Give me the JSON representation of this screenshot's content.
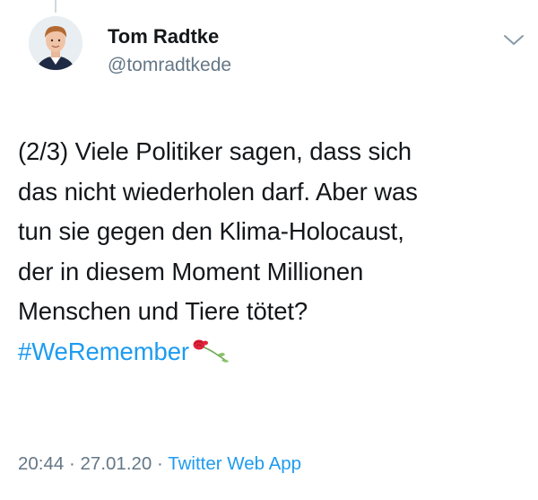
{
  "author": {
    "display_name": "Tom Radtke",
    "handle": "@tomradtkede"
  },
  "tweet": {
    "lines": [
      "(2/3) Viele Politiker sagen, dass sich",
      "das nicht wiederholen darf. Aber was",
      "tun sie gegen den Klima-Holocaust,",
      "der in diesem Moment Millionen",
      "Menschen und Tiere tötet?"
    ],
    "hashtag": "#WeRemember",
    "emoji": "rose-icon"
  },
  "meta": {
    "time": "20:44",
    "separator_1": " · ",
    "date": "27.01.20",
    "separator_2": " · ",
    "source": "Twitter Web App"
  },
  "colors": {
    "link": "#1d9bf0",
    "secondary_text": "#657786",
    "primary_text": "#14171a"
  },
  "icons": {
    "more_menu": "chevron-down-icon"
  }
}
